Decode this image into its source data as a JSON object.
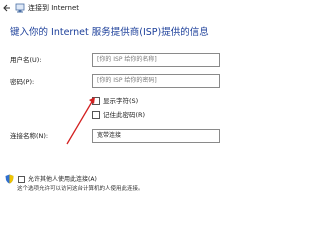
{
  "window": {
    "title": "连接到 Internet"
  },
  "heading": "键入你的 Internet 服务提供商(ISP)提供的信息",
  "form": {
    "username": {
      "label": "用户名(U):",
      "placeholder": "[你的 ISP 给你的名称]"
    },
    "password": {
      "label": "密码(P):",
      "placeholder": "[你的 ISP 给你的密码]"
    },
    "show_chars": {
      "label": "显示字符(S)",
      "checked": false
    },
    "remember_password": {
      "label": "记住此密码(R)",
      "checked": false
    },
    "connection_name": {
      "label": "连接名称(N):",
      "value": "宽带连接"
    }
  },
  "allow_others": {
    "label": "允许其他人使用此连接(A)",
    "note": "这个选项允许可以访问这台计算机的人使用此连接。",
    "checked": false
  },
  "colors": {
    "heading": "#1c3f9a",
    "annotation_arrow": "#d32020",
    "shield_blue": "#2f6fd0",
    "shield_yellow": "#f0c400"
  },
  "icons": {
    "back": "back-arrow-icon",
    "network": "network-icon",
    "shield": "shield-icon"
  }
}
